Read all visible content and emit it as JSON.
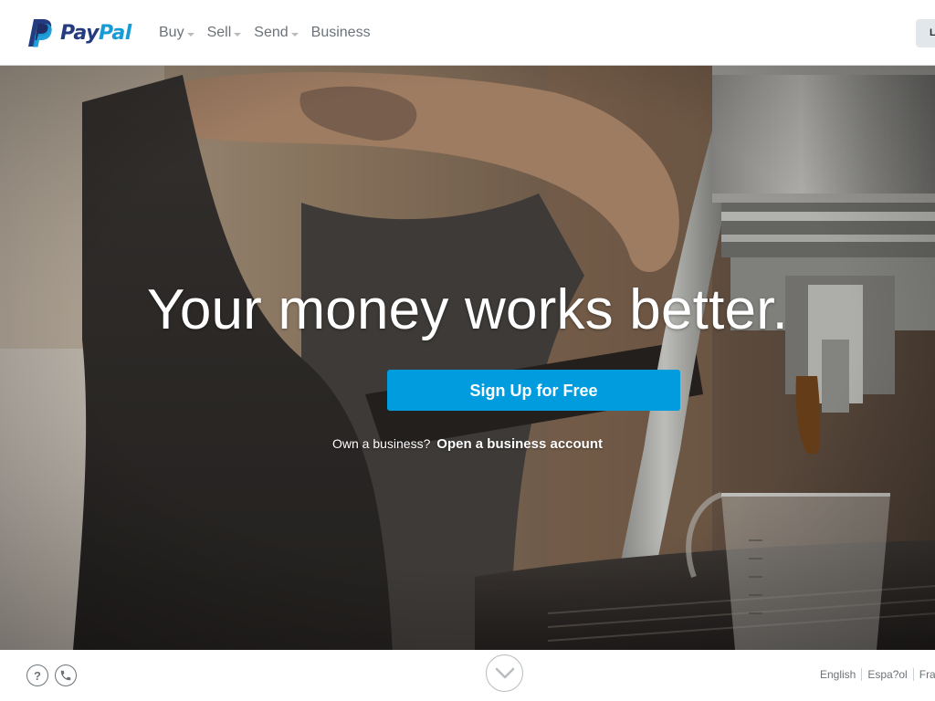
{
  "brand": {
    "wordmark_pay": "Pay",
    "wordmark_pal": "Pal",
    "colors": {
      "pay": "#253b80",
      "pal": "#179bd7"
    }
  },
  "nav": {
    "items": [
      {
        "label": "Buy",
        "has_dropdown": true
      },
      {
        "label": "Sell",
        "has_dropdown": true
      },
      {
        "label": "Send",
        "has_dropdown": true
      },
      {
        "label": "Business",
        "has_dropdown": false
      }
    ],
    "login_label": "L"
  },
  "hero": {
    "headline": "Your money works better.",
    "cta_label": "Sign Up for Free",
    "cta_color": "#009cde",
    "business_prompt": "Own a business?",
    "business_link": "Open a business account"
  },
  "footer": {
    "help_icon": "question-mark-icon",
    "help_glyph": "?",
    "phone_icon": "phone-icon",
    "scroll_icon": "chevron-down-icon",
    "languages": [
      "English",
      "Espa?ol",
      "Fran"
    ]
  }
}
